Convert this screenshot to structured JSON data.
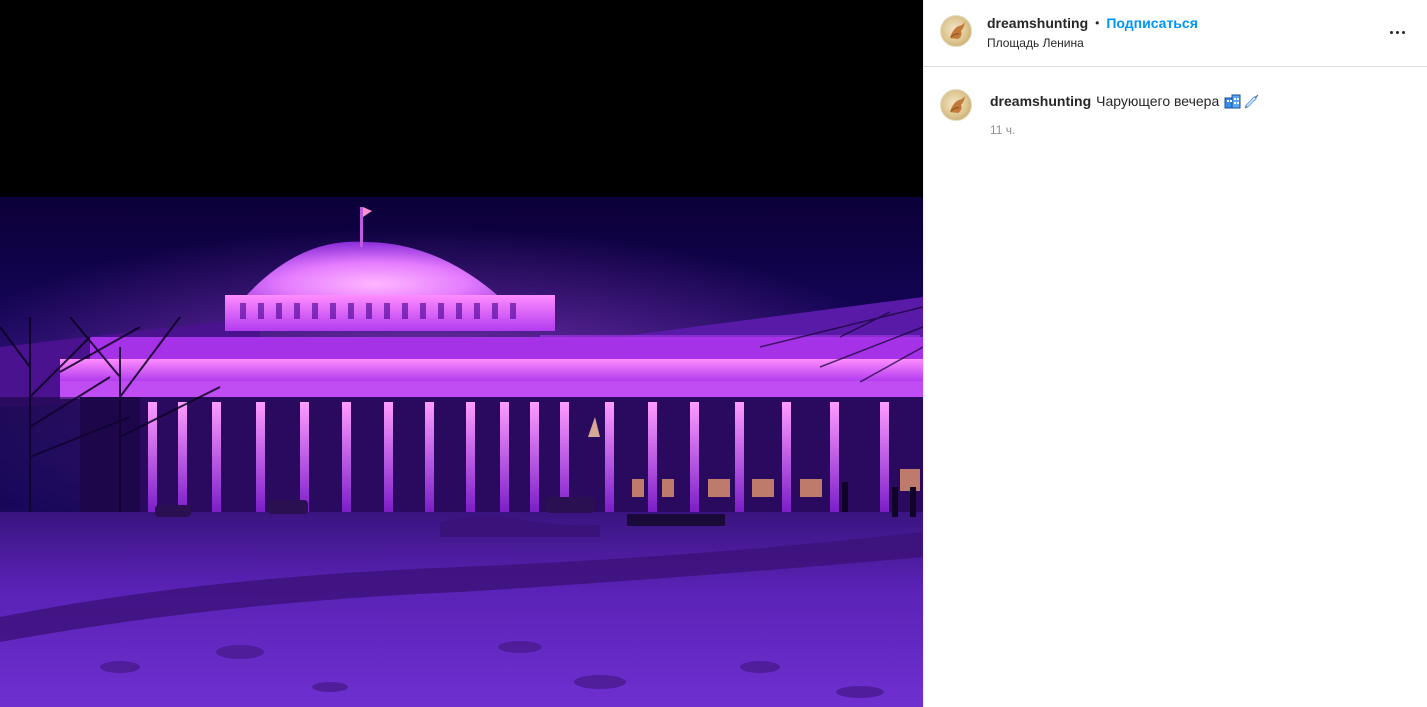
{
  "post": {
    "author": {
      "username": "dreamshunting",
      "follow_label": "Подписаться",
      "separator": "•",
      "location": "Площадь Ленина"
    },
    "more_icon": "more-horizontal-icon",
    "caption": {
      "username": "dreamshunting",
      "text": "Чарующего вечера",
      "emoji": [
        "building-emoji",
        "syringe-emoji"
      ],
      "time": "11 ч."
    }
  },
  "colors": {
    "accent": "#0095f6",
    "text": "#262626",
    "muted": "#8e8e8e",
    "light_glow": "#c84cff",
    "sky": "#16004f"
  }
}
